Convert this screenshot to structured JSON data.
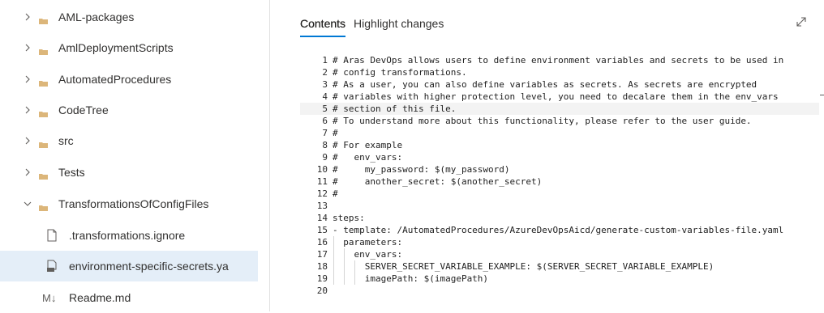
{
  "tree": {
    "items": [
      {
        "label": "AML-packages",
        "kind": "folder",
        "expanded": false
      },
      {
        "label": "AmlDeploymentScripts",
        "kind": "folder",
        "expanded": false
      },
      {
        "label": "AutomatedProcedures",
        "kind": "folder",
        "expanded": false
      },
      {
        "label": "CodeTree",
        "kind": "folder",
        "expanded": false
      },
      {
        "label": "src",
        "kind": "folder",
        "expanded": false
      },
      {
        "label": "Tests",
        "kind": "folder",
        "expanded": false
      },
      {
        "label": "TransformationsOfConfigFiles",
        "kind": "folder",
        "expanded": true
      },
      {
        "label": ".transformations.ignore",
        "kind": "file",
        "icon": "file-icon"
      },
      {
        "label": "environment-specific-secrets.ya",
        "kind": "file",
        "icon": "yaml-file-icon",
        "selected": true
      },
      {
        "label": "Readme.md",
        "kind": "file",
        "icon": "markdown-icon",
        "icon_glyph": "M↓"
      }
    ]
  },
  "panel": {
    "tabs": [
      {
        "label": "Contents",
        "active": true
      },
      {
        "label": "Highlight changes",
        "active": false
      }
    ],
    "expand_icon": "expand-diagonal-icon"
  },
  "editor": {
    "lines": [
      {
        "n": "1",
        "text": "# Aras DevOps allows users to define environment variables and secrets to be used in"
      },
      {
        "n": "2",
        "text": "# config transformations."
      },
      {
        "n": "3",
        "text": "# As a user, you can also define variables as secrets. As secrets are encrypted"
      },
      {
        "n": "4",
        "text": "# variables with higher protection level, you need to decalare them in the env_vars"
      },
      {
        "n": "5",
        "text": "# section of this file.",
        "current": true
      },
      {
        "n": "6",
        "text": "# To understand more about this functionality, please refer to the user guide."
      },
      {
        "n": "7",
        "text": "#"
      },
      {
        "n": "8",
        "text": "# For example"
      },
      {
        "n": "9",
        "text": "#   env_vars:"
      },
      {
        "n": "10",
        "text": "#     my_password: $(my_password)"
      },
      {
        "n": "11",
        "text": "#     another_secret: $(another_secret)"
      },
      {
        "n": "12",
        "text": "#"
      },
      {
        "n": "13",
        "text": ""
      },
      {
        "n": "14",
        "text": "steps:"
      },
      {
        "n": "15",
        "text": "- template: /AutomatedProcedures/AzureDevOpsAicd/generate-custom-variables-file.yaml"
      },
      {
        "n": "16",
        "text": "  parameters:"
      },
      {
        "n": "17",
        "text": "    env_vars:"
      },
      {
        "n": "18",
        "text": "      SERVER_SECRET_VARIABLE_EXAMPLE: $(SERVER_SECRET_VARIABLE_EXAMPLE)"
      },
      {
        "n": "19",
        "text": "      imagePath: $(imagePath)"
      },
      {
        "n": "20",
        "text": ""
      }
    ]
  },
  "colors": {
    "accent": "#0078d4",
    "folder": "#dcb67a",
    "selected_row": "#e4eef8"
  }
}
